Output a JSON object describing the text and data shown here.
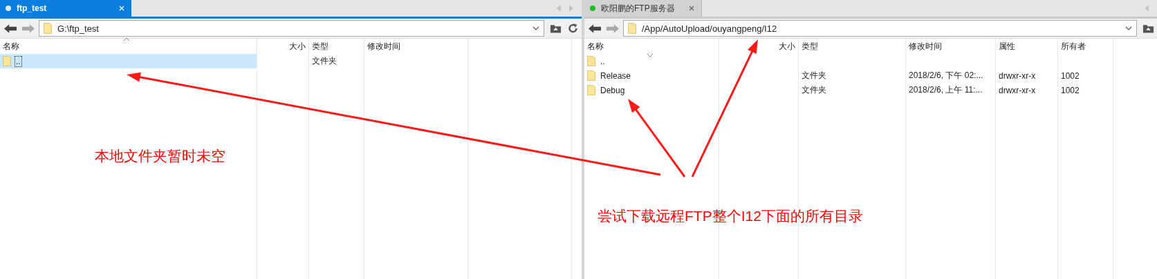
{
  "panes": [
    {
      "tab": {
        "label": "ftp_test",
        "selected": true,
        "connected": false
      },
      "path": "G:\\ftp_test",
      "columns": [
        {
          "label": "名称",
          "sort_ascending": true
        },
        {
          "label": "大小"
        },
        {
          "label": "类型"
        },
        {
          "label": "修改时间"
        }
      ],
      "rows": [
        {
          "name": "..",
          "type": "文件夹",
          "selected": true
        }
      ]
    },
    {
      "tab": {
        "label": "欧阳鹏的FTP服务器",
        "selected": false,
        "connected": true
      },
      "path": "/App/AutoUpload/ouyangpeng/I12",
      "columns": [
        {
          "label": "名称",
          "sort_ascending": false
        },
        {
          "label": "大小"
        },
        {
          "label": "类型"
        },
        {
          "label": "修改时间"
        },
        {
          "label": "属性"
        },
        {
          "label": "所有者"
        }
      ],
      "rows": [
        {
          "name": "..",
          "selected": false
        },
        {
          "name": "Release",
          "type": "文件夹",
          "modified": "2018/2/6, 下午 02:...",
          "attributes": "drwxr-xr-x",
          "owner": "1002",
          "selected": false
        },
        {
          "name": "Debug",
          "type": "文件夹",
          "modified": "2018/2/6, 上午 11:...",
          "attributes": "drwxr-xr-x",
          "owner": "1002",
          "selected": false
        }
      ]
    }
  ],
  "annotations": [
    {
      "text": "本地文件夹暂时未空"
    },
    {
      "text": "尝试下载远程FTP整个I12下面的所有目录"
    }
  ]
}
